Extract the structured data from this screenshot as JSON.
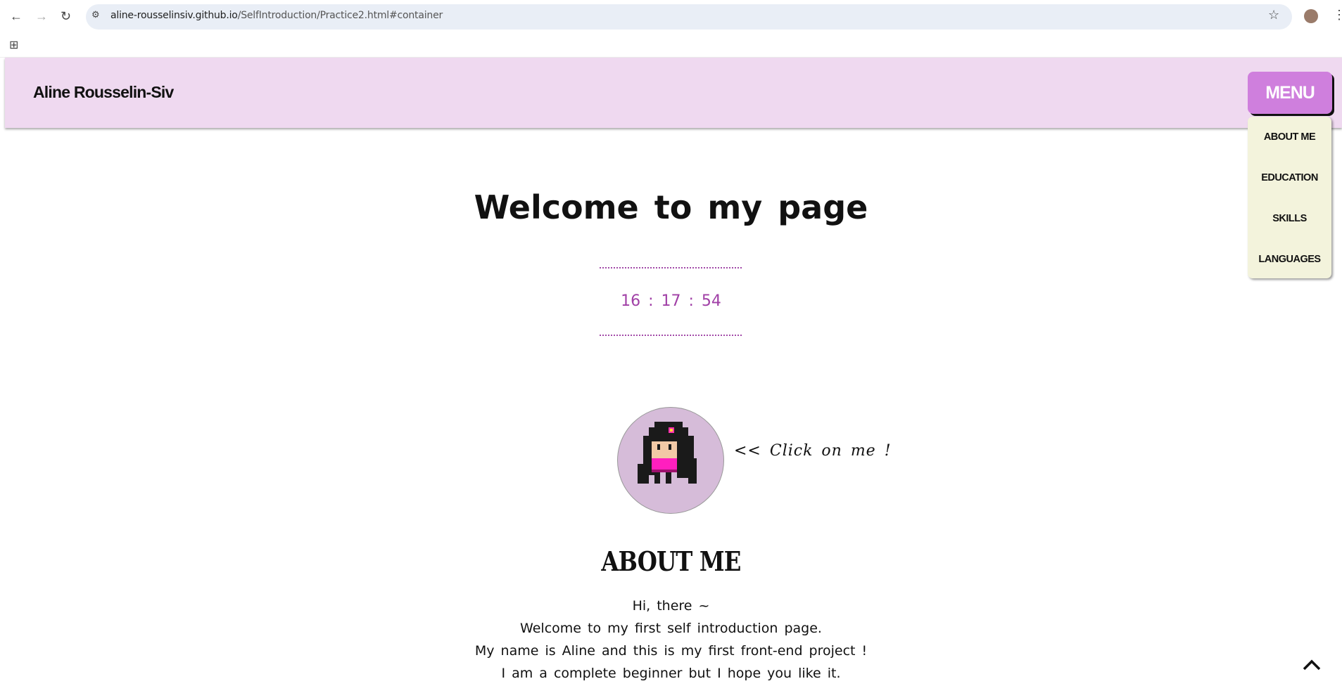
{
  "browser": {
    "url_host": "aline-rousselinsiv.github.io",
    "url_path": "/SelfIntroduction/Practice2.html#container"
  },
  "header": {
    "brand": "Aline Rousselin-Siv",
    "menu_label": "MENU",
    "menu_items": [
      "ABOUT ME",
      "EDUCATION",
      "SKILLS",
      "LANGUAGES"
    ]
  },
  "colors": {
    "header_bg": "#efd9f0",
    "menu_button": "#cf7fdd",
    "dropdown_bg": "#f3f3dc",
    "clock": "#a03fa6",
    "avatar_bg": "#d6bcd9"
  },
  "main": {
    "title": "Welcome to my page",
    "clock": "16 : 17 : 54",
    "avatar_hint": "<< Click on me !",
    "section_title": "ABOUT ME",
    "about_lines": [
      "Hi, there ~",
      "Welcome to my first self introduction page.",
      "My name is Aline and this is my first front-end project !",
      "I am a complete beginner but I hope you like it."
    ]
  }
}
